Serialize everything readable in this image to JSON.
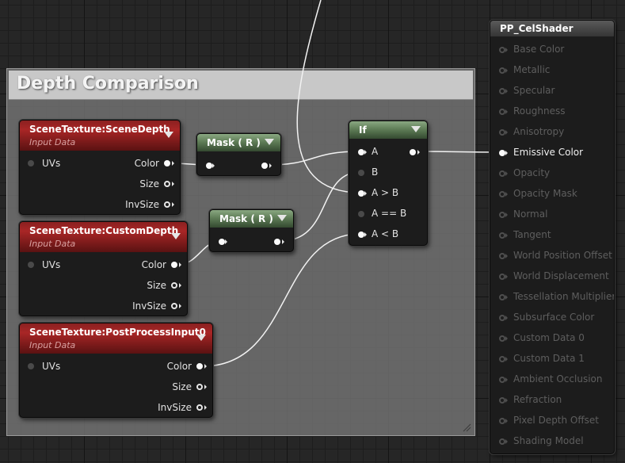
{
  "comment_box": {
    "title": "Depth Comparison"
  },
  "nodes": {
    "scene_depth": {
      "title": "SceneTexture:SceneDepth",
      "subtitle": "Input Data",
      "input": "UVs",
      "outputs": [
        "Color",
        "Size",
        "InvSize"
      ]
    },
    "custom_depth": {
      "title": "SceneTexture:CustomDepth",
      "subtitle": "Input Data",
      "input": "UVs",
      "outputs": [
        "Color",
        "Size",
        "InvSize"
      ]
    },
    "post_process": {
      "title": "SceneTexture:PostProcessInput0",
      "subtitle": "Input Data",
      "input": "UVs",
      "outputs": [
        "Color",
        "Size",
        "InvSize"
      ]
    },
    "mask1": {
      "title": "Mask ( R )"
    },
    "mask2": {
      "title": "Mask ( R )"
    },
    "if_node": {
      "title": "If",
      "inputs": [
        "A",
        "B",
        "A > B",
        "A == B",
        "A < B"
      ]
    },
    "output": {
      "title": "PP_CelShader",
      "pins": [
        "Base Color",
        "Metallic",
        "Specular",
        "Roughness",
        "Anisotropy",
        "Emissive Color",
        "Opacity",
        "Opacity Mask",
        "Normal",
        "Tangent",
        "World Position Offset",
        "World Displacement",
        "Tessellation Multiplier",
        "Subsurface Color",
        "Custom Data 0",
        "Custom Data 1",
        "Ambient Occlusion",
        "Refraction",
        "Pixel Depth Offset",
        "Shading Model"
      ],
      "active_pin": "Emissive Color"
    }
  },
  "colors": {
    "red_header": "#a92626",
    "green_header": "#5f7d57",
    "wire": "#ffffff",
    "comment_bg": "#787878"
  }
}
